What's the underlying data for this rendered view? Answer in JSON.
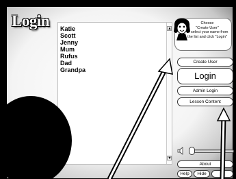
{
  "window": {
    "title": "Login"
  },
  "user_list": {
    "items": [
      "Katie",
      "Scott",
      "Jenny",
      "Mum",
      "Rufus",
      "Dad",
      "Grandpa"
    ],
    "scroll_up_glyph": "▲",
    "scroll_down_glyph": "▼"
  },
  "help_tip": {
    "line1": "Choose",
    "line2": "\"Create User\"",
    "line3": "or select your name from",
    "line4": "the list and click \"Login\""
  },
  "buttons": {
    "create_user": "Create User",
    "login": "Login",
    "admin_login": "Admin Login",
    "lesson_content": "Lesson Content",
    "about": "About",
    "help": "Help",
    "hide": "Hide"
  },
  "volume": {
    "level": 0.05
  },
  "icons": {
    "helper": "cartoon-girl-icon",
    "speaker": "speaker-icon"
  },
  "colors": {
    "background": "#000000",
    "panel": "#ffffff",
    "text": "#000000"
  }
}
